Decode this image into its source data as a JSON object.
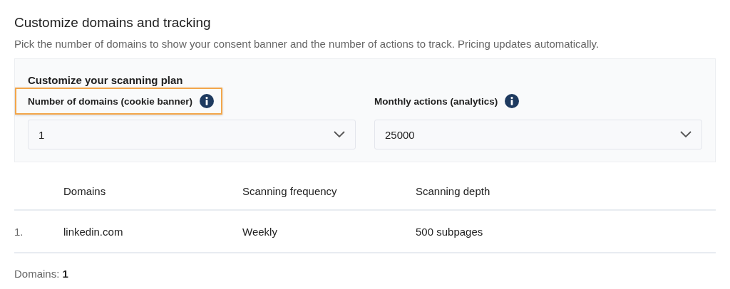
{
  "title": "Customize domains and tracking",
  "description": "Pick the number of domains to show your consent banner and the number of actions to track. Pricing updates automatically.",
  "plan": {
    "title": "Customize your scanning plan",
    "fields": [
      {
        "label": "Number of domains (cookie banner)",
        "value": "1",
        "highlighted": true
      },
      {
        "label": "Monthly actions (analytics)",
        "value": "25000",
        "highlighted": false
      }
    ]
  },
  "table": {
    "columns": [
      "Domains",
      "Scanning frequency",
      "Scanning depth"
    ],
    "rows": [
      {
        "number": "1.",
        "cells": [
          "linkedin.com",
          "Weekly",
          "500 subpages"
        ]
      }
    ]
  },
  "footer": "Domains: **1**"
}
